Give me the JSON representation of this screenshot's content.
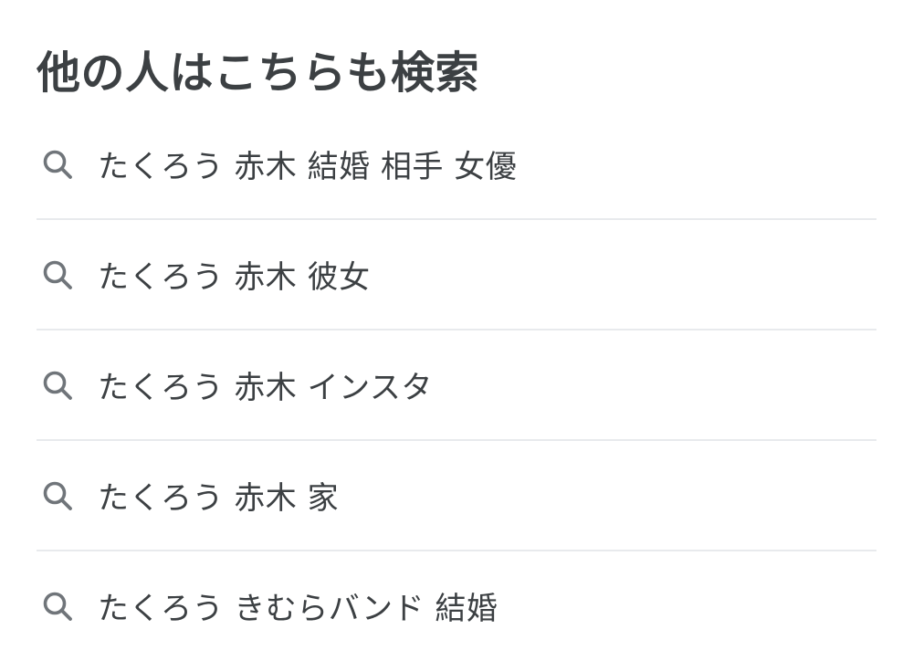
{
  "section": {
    "title": "他の人はこちらも検索"
  },
  "suggestions": [
    {
      "label": "たくろう 赤木 結婚 相手 女優",
      "icon": "search-icon"
    },
    {
      "label": "たくろう 赤木 彼女",
      "icon": "search-icon"
    },
    {
      "label": "たくろう 赤木 インスタ",
      "icon": "search-icon"
    },
    {
      "label": "たくろう 赤木 家",
      "icon": "search-icon"
    },
    {
      "label": "たくろう きむらバンド 結婚",
      "icon": "search-icon"
    }
  ],
  "colors": {
    "text": "#3c4043",
    "icon": "#70757a",
    "divider": "#e8eaed",
    "background": "#ffffff"
  }
}
